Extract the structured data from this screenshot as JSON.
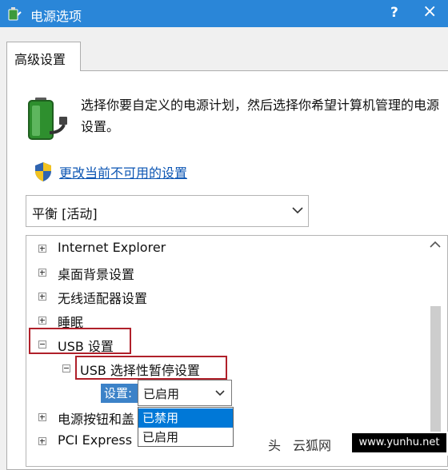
{
  "window": {
    "title": "电源选项",
    "help_label": "?",
    "close_label": "×"
  },
  "tab": {
    "label": "高级设置"
  },
  "description": "选择你要自定义的电源计划，然后选择你希望计算机管理的电源设置。",
  "change_link": "更改当前不可用的设置",
  "plan_select": {
    "value": "平衡 [活动]"
  },
  "tree": {
    "items": [
      "Internet Explorer",
      "桌面背景设置",
      "无线适配器设置",
      "睡眠",
      "USB 设置",
      "USB 选择性暂停设置",
      "电源按钮和盖",
      "PCI Express"
    ]
  },
  "setting": {
    "label": "设置:",
    "value": "已启用",
    "options": [
      "已禁用",
      "已启用"
    ],
    "selected_option": "已禁用"
  },
  "watermark": {
    "head": "头",
    "brand": "云狐网",
    "url": "www.yunhu.net"
  },
  "colors": {
    "titlebar": "#2a86d8",
    "highlight": "#b0202a",
    "selection": "#0078d7",
    "link": "#0b55b3"
  }
}
